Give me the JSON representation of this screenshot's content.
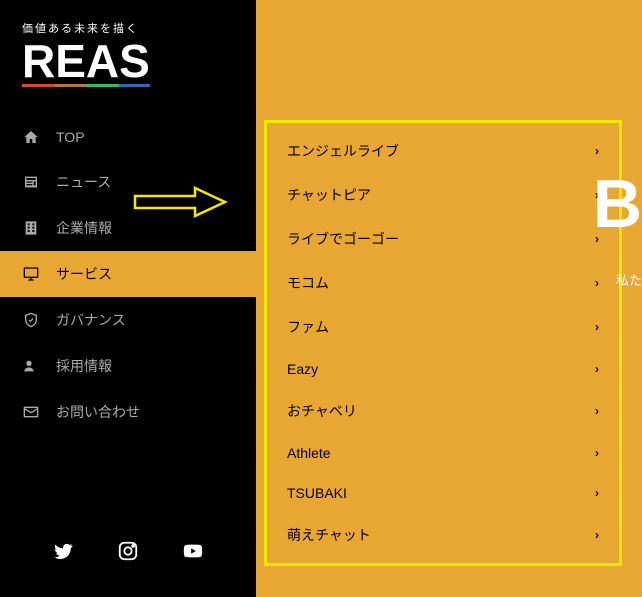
{
  "logo": {
    "tagline": "価値ある未来を描く",
    "letters": [
      "R",
      "E",
      "A",
      "S"
    ]
  },
  "nav": {
    "items": [
      {
        "label": "TOP",
        "icon": "home"
      },
      {
        "label": "ニュース",
        "icon": "news"
      },
      {
        "label": "企業情報",
        "icon": "building"
      },
      {
        "label": "サービス",
        "icon": "monitor",
        "active": true
      },
      {
        "label": "ガバナンス",
        "icon": "shield"
      },
      {
        "label": "採用情報",
        "icon": "person-plus"
      },
      {
        "label": "お問い合わせ",
        "icon": "mail"
      }
    ]
  },
  "submenu": {
    "items": [
      {
        "label": "エンジェルライブ"
      },
      {
        "label": "チャットピア"
      },
      {
        "label": "ライブでゴーゴー"
      },
      {
        "label": "モコム"
      },
      {
        "label": "ファム"
      },
      {
        "label": "Eazy"
      },
      {
        "label": "おチャベリ"
      },
      {
        "label": "Athlete"
      },
      {
        "label": "TSUBAKI"
      },
      {
        "label": "萌えチャット"
      }
    ]
  },
  "page_edge": "B",
  "page_subtext": "私た"
}
